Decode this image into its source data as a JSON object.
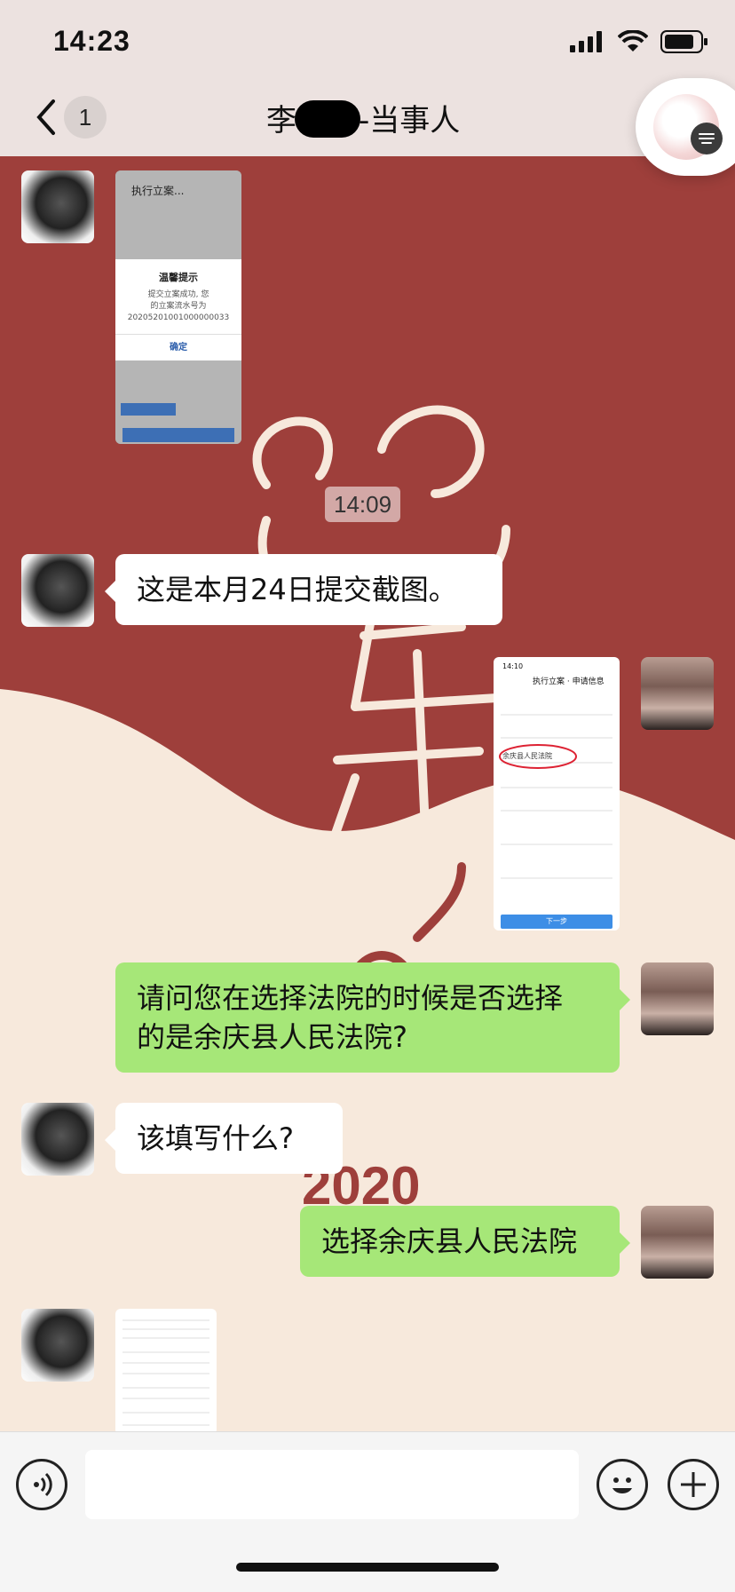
{
  "status_bar": {
    "time": "14:23"
  },
  "nav": {
    "unread_count": "1",
    "title_prefix": "李",
    "title_suffix": "-当事人"
  },
  "chat": {
    "timestamp": "14:09",
    "messages": [
      {
        "side": "left",
        "type": "image"
      },
      {
        "side": "left",
        "type": "text",
        "text": "这是本月24日提交截图。"
      },
      {
        "side": "right",
        "type": "image"
      },
      {
        "side": "right",
        "type": "text",
        "lines": [
          "请问您在选择法院的时候是否选择",
          "的是余庆县人民法院?"
        ]
      },
      {
        "side": "left",
        "type": "text",
        "text": "该填写什么?"
      },
      {
        "side": "right",
        "type": "text",
        "text": "选择余庆县人民法院"
      },
      {
        "side": "left",
        "type": "image"
      }
    ]
  },
  "shot1": {
    "header": "执行立案...",
    "dialog_title": "温馨提示",
    "dialog_body": [
      "提交立案成功, 您",
      "的立案流水号为",
      "20205201001000000033"
    ],
    "dialog_button": "确定"
  },
  "shot2": {
    "time": "14:10",
    "header": "执行立案 · 申请信息",
    "selected_court": "余庆县人民法院",
    "next_button": "下一步"
  },
  "icons": {
    "back": "chevron-left-icon",
    "voice": "voice-icon",
    "emoji": "emoji-icon",
    "plus": "plus-icon",
    "signal": "signal-icon",
    "wifi": "wifi-icon",
    "battery": "battery-icon"
  },
  "colors": {
    "bubble_green": "#a6e778",
    "bubble_white": "#ffffff",
    "bg_red": "#9e3f3b",
    "bg_cream": "#f7e9dc"
  }
}
